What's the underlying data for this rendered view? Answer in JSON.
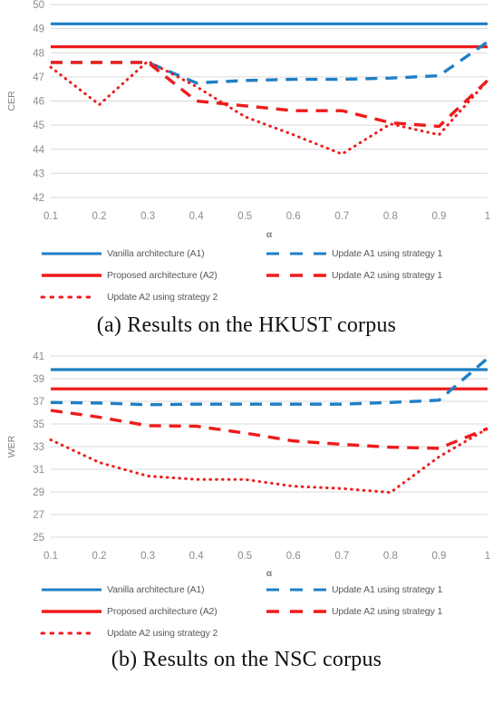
{
  "figure": {
    "panels": [
      {
        "id": "panel-a",
        "caption": "(a) Results on the HKUST corpus",
        "chart_data": {
          "type": "line",
          "title": "",
          "xlabel": "α",
          "ylabel": "CER",
          "x": [
            0.1,
            0.2,
            0.3,
            0.4,
            0.5,
            0.6,
            0.7,
            0.8,
            0.9,
            1.0
          ],
          "xtick_labels": [
            "0.1",
            "0.2",
            "0.3",
            "0.4",
            "0.5",
            "0.6",
            "0.7",
            "0.8",
            "0.9",
            "1"
          ],
          "ylim": [
            42,
            50
          ],
          "ytick_labels": [
            "42",
            "43",
            "44",
            "45",
            "46",
            "47",
            "48",
            "49",
            "50"
          ],
          "yticks": [
            42,
            43,
            44,
            45,
            46,
            47,
            48,
            49,
            50
          ],
          "grid": true,
          "legend_position": "bottom",
          "series": [
            {
              "name": "Vanilla architecture (A1)",
              "style": "solid",
              "color": "#1f7fc4",
              "constant": 49.2,
              "values": [
                49.2,
                49.2,
                49.2,
                49.2,
                49.2,
                49.2,
                49.2,
                49.2,
                49.2,
                49.2
              ]
            },
            {
              "name": "Proposed architecture (A2)",
              "style": "solid",
              "color": "#ee1b1b",
              "constant": 48.25,
              "values": [
                48.25,
                48.25,
                48.25,
                48.25,
                48.25,
                48.25,
                48.25,
                48.25,
                48.25,
                48.25
              ]
            },
            {
              "name": "Update A1 using strategy 1",
              "style": "dashed",
              "color": "#1f7fc4",
              "values": [
                47.6,
                47.6,
                47.6,
                46.75,
                46.85,
                46.9,
                46.9,
                46.95,
                47.05,
                48.45
              ]
            },
            {
              "name": "Update A2 using strategy 1",
              "style": "dashed",
              "color": "#ee1b1b",
              "values": [
                47.6,
                47.6,
                47.6,
                46.0,
                45.8,
                45.6,
                45.6,
                45.1,
                44.95,
                46.85
              ]
            },
            {
              "name": "Update A2 using strategy 2",
              "style": "dotted",
              "color": "#ee1b1b",
              "values": [
                47.4,
                45.85,
                47.65,
                46.6,
                45.35,
                44.6,
                43.8,
                45.05,
                44.6,
                46.85
              ]
            }
          ]
        }
      },
      {
        "id": "panel-b",
        "caption": "(b) Results on the NSC corpus",
        "chart_data": {
          "type": "line",
          "title": "",
          "xlabel": "α",
          "ylabel": "WER",
          "x": [
            0.1,
            0.2,
            0.3,
            0.4,
            0.5,
            0.6,
            0.7,
            0.8,
            0.9,
            1.0
          ],
          "xtick_labels": [
            "0.1",
            "0.2",
            "0.3",
            "0.4",
            "0.5",
            "0.6",
            "0.7",
            "0.8",
            "0.9",
            "1"
          ],
          "ylim": [
            25,
            41
          ],
          "ytick_labels": [
            "25",
            "27",
            "29",
            "31",
            "33",
            "35",
            "37",
            "39",
            "41"
          ],
          "yticks": [
            25,
            27,
            29,
            31,
            33,
            35,
            37,
            39,
            41
          ],
          "grid": true,
          "legend_position": "bottom",
          "series": [
            {
              "name": "Vanilla architecture (A1)",
              "style": "solid",
              "color": "#1f7fc4",
              "constant": 39.8,
              "values": [
                39.8,
                39.8,
                39.8,
                39.8,
                39.8,
                39.8,
                39.8,
                39.8,
                39.8,
                39.8
              ]
            },
            {
              "name": "Proposed architecture (A2)",
              "style": "solid",
              "color": "#ee1b1b",
              "constant": 38.1,
              "values": [
                38.1,
                38.1,
                38.1,
                38.1,
                38.1,
                38.1,
                38.1,
                38.1,
                38.1,
                38.1
              ]
            },
            {
              "name": "Update A1 using strategy 1",
              "style": "dashed",
              "color": "#1f7fc4",
              "values": [
                36.9,
                36.85,
                36.7,
                36.75,
                36.75,
                36.75,
                36.75,
                36.9,
                37.1,
                40.8
              ]
            },
            {
              "name": "Update A2 using strategy 1",
              "style": "dashed",
              "color": "#ee1b1b",
              "values": [
                36.2,
                35.6,
                34.85,
                34.8,
                34.2,
                33.5,
                33.2,
                32.95,
                32.85,
                34.6
              ]
            },
            {
              "name": "Update A2 using strategy 2",
              "style": "dotted",
              "color": "#ee1b1b",
              "values": [
                33.6,
                31.6,
                30.4,
                30.1,
                30.1,
                29.5,
                29.3,
                28.95,
                32.1,
                34.6
              ]
            }
          ]
        }
      }
    ],
    "legend": {
      "rows": [
        [
          {
            "label": "Vanilla architecture (A1)",
            "style": "solid",
            "color": "#1f7fc4",
            "swatch": "legend-swatch-solid-blue"
          },
          {
            "label": "Update A1 using strategy 1",
            "style": "dashed",
            "color": "#1f7fc4",
            "swatch": "legend-swatch-dashed-blue"
          }
        ],
        [
          {
            "label": "Proposed architecture (A2)",
            "style": "solid",
            "color": "#ee1b1b",
            "swatch": "legend-swatch-solid-red"
          },
          {
            "label": "Update A2 using strategy 1",
            "style": "dashed",
            "color": "#ee1b1b",
            "swatch": "legend-swatch-dashed-red"
          }
        ],
        [
          {
            "label": "Update A2 using strategy 2",
            "style": "dotted",
            "color": "#ee1b1b",
            "swatch": "legend-swatch-dotted-red"
          }
        ]
      ]
    },
    "colors": {
      "blue": "#1f7fc4",
      "red": "#ee1b1b",
      "gridline": "#d9d9d9",
      "tick_text": "#8c8c8c",
      "axis_title": "#7f7f7f",
      "legend_text": "#595959",
      "background": "#ffffff"
    }
  }
}
